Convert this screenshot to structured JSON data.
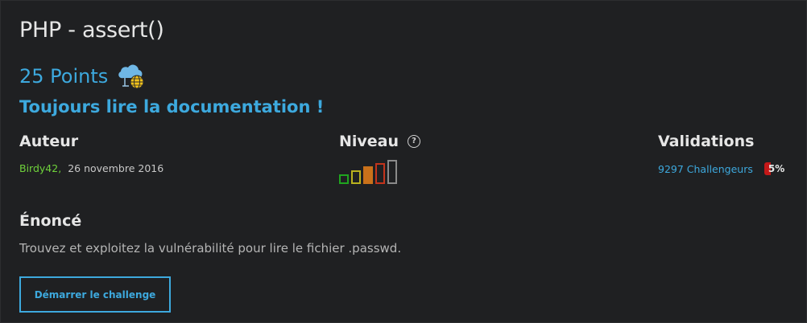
{
  "challenge": {
    "title": "PHP - assert()",
    "points": "25 Points",
    "category_icon": "web-server-globe-icon",
    "subtitle": "Toujours lire la documentation !"
  },
  "author": {
    "heading": "Auteur",
    "name": "Birdy42",
    "separator": ",",
    "date": "26 novembre 2016"
  },
  "level": {
    "heading": "Niveau",
    "help_icon": "question-circle-icon",
    "current_level": 3,
    "max_level": 5,
    "colors": [
      "#1fa51f",
      "#b9b21e",
      "#c9711a",
      "#c3341c",
      "#8a8a8a"
    ]
  },
  "validations": {
    "heading": "Validations",
    "count": "9297 Challengeurs",
    "percent": "5%",
    "percent_color": "#c41818"
  },
  "statement": {
    "heading": "Énoncé",
    "text": "Trouvez et exploitez la vulnérabilité pour lire le fichier .passwd."
  },
  "actions": {
    "start_label": "Démarrer le challenge"
  }
}
